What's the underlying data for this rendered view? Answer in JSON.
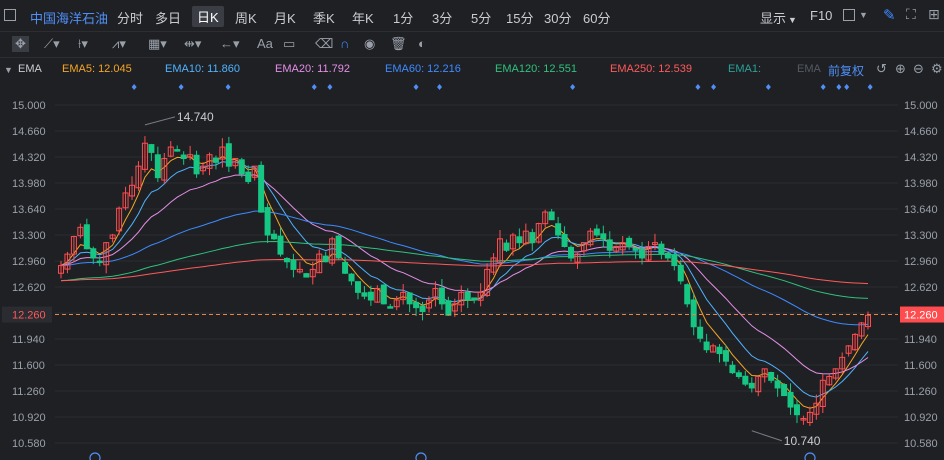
{
  "header": {
    "stock_name": "中国海洋石油",
    "periods": [
      "分时",
      "多日",
      "日K",
      "周K",
      "月K",
      "季K",
      "年K",
      "1分",
      "3分",
      "5分",
      "15分",
      "30分",
      "60分"
    ],
    "active_period": "日K",
    "display_label": "显示",
    "f10_label": "F10"
  },
  "toolbar": {
    "text_tool": "Aa"
  },
  "ema_bar": {
    "indicator": "EMA",
    "items": [
      {
        "label": "EMA5: 12.045",
        "color": "#f5a623"
      },
      {
        "label": "EMA10: 11.860",
        "color": "#4fb3ff"
      },
      {
        "label": "EMA20: 11.792",
        "color": "#e58fe8"
      },
      {
        "label": "EMA60: 12.216",
        "color": "#3d8bff"
      },
      {
        "label": "EMA120: 12.551",
        "color": "#2ec27e"
      },
      {
        "label": "EMA250: 12.539",
        "color": "#ff5a5a"
      },
      {
        "label": "EMA1:",
        "color": "#2aa198"
      },
      {
        "label": "EMA",
        "color": "#555a62"
      }
    ],
    "adjust_label": "前复权"
  },
  "colors": {
    "up": "#ff4d4f",
    "down": "#16c784",
    "grid": "#2a2c31",
    "price_line": "#e8834a"
  },
  "chart_data": {
    "type": "candlestick",
    "y_ticks": [
      15.0,
      14.66,
      14.32,
      13.98,
      13.64,
      13.3,
      12.96,
      12.62,
      12.28,
      11.94,
      11.6,
      11.26,
      10.92,
      10.58
    ],
    "ylim": [
      10.58,
      15.0
    ],
    "current_price": "12.260",
    "annotations": [
      {
        "text": "14.740",
        "index": 13,
        "price": 14.74
      },
      {
        "text": "10.740",
        "index": 107,
        "price": 10.74
      }
    ],
    "close": [
      12.9,
      13.05,
      13.28,
      13.4,
      13.12,
      13.0,
      12.95,
      13.2,
      13.3,
      13.65,
      13.85,
      13.95,
      14.2,
      14.5,
      14.38,
      14.05,
      14.3,
      14.45,
      14.4,
      14.3,
      14.35,
      14.1,
      14.2,
      14.35,
      14.25,
      14.45,
      14.2,
      14.3,
      14.1,
      14.0,
      14.2,
      13.6,
      13.3,
      13.25,
      13.05,
      12.95,
      12.85,
      12.85,
      12.75,
      12.85,
      13.05,
      12.95,
      13.25,
      13.0,
      12.8,
      12.7,
      12.55,
      12.5,
      12.45,
      12.6,
      12.4,
      12.35,
      12.45,
      12.55,
      12.4,
      12.35,
      12.3,
      12.45,
      12.6,
      12.4,
      12.25,
      12.4,
      12.55,
      12.45,
      12.45,
      12.55,
      12.85,
      13.0,
      13.25,
      13.1,
      13.3,
      13.2,
      13.35,
      13.2,
      13.45,
      13.6,
      13.5,
      13.3,
      13.15,
      13.0,
      13.05,
      13.2,
      13.35,
      13.3,
      13.25,
      13.1,
      13.15,
      13.2,
      13.15,
      13.1,
      13.0,
      13.15,
      13.2,
      13.05,
      13.0,
      12.9,
      12.7,
      12.4,
      12.1,
      11.95,
      11.8,
      11.85,
      11.75,
      11.65,
      11.5,
      11.45,
      11.35,
      11.3,
      11.45,
      11.55,
      11.4,
      11.3,
      11.2,
      11.05,
      10.95,
      10.9,
      10.98,
      11.1,
      11.4,
      11.45,
      11.55,
      11.7,
      11.85,
      12.0,
      12.15,
      12.25
    ]
  }
}
